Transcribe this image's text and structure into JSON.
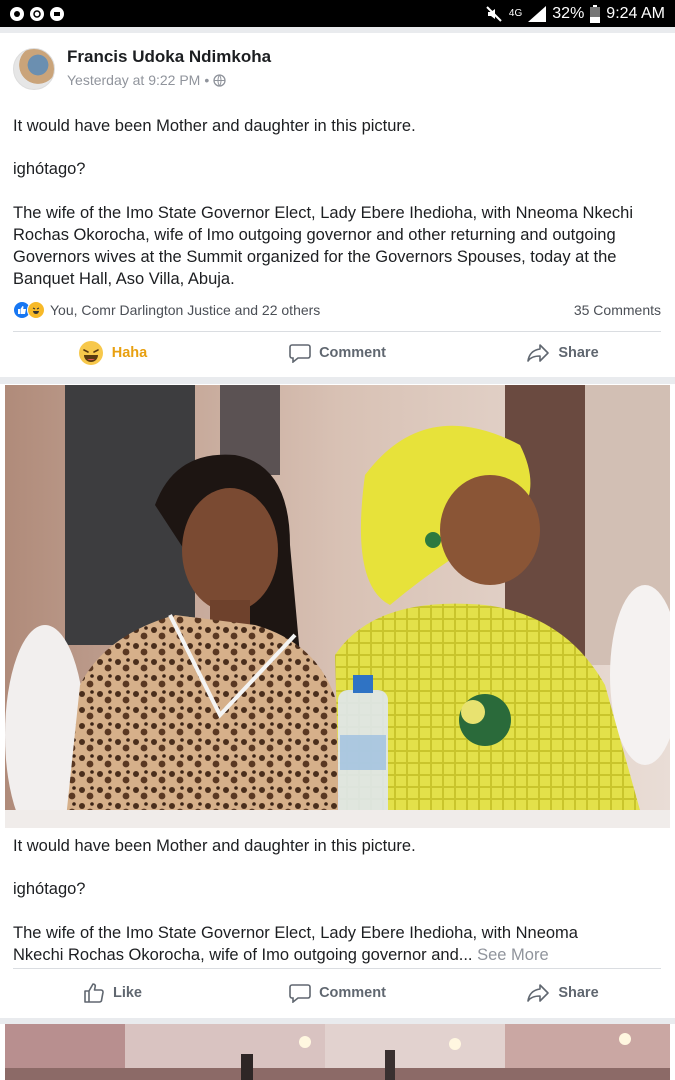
{
  "status_bar": {
    "network": "4G",
    "battery": "32%",
    "time": "9:24 AM"
  },
  "post1": {
    "author": "Francis Udoka Ndimkoha",
    "time": "Yesterday at 9:22 PM",
    "meta_sep": "•",
    "text_line1": "It would have been Mother and daughter in this picture.",
    "text_line2": "ighótago?",
    "text_line3a": "The wife of the Imo State Governor Elect, Lady Ebere Ihedioha, with Nneoma Nkechi",
    "text_line3b": "Rochas Okorocha, wife of Imo outgoing governor and other returning and outgoing",
    "text_line3c": "Governors wives at the Summit organized for the Governors Spouses, today at the",
    "text_line3d": "Banquet Hall, Aso Villa, Abuja.",
    "reactions_text": "You, Comr Darlington Justice and 22 others",
    "comments_count": "35 Comments",
    "actions": {
      "haha": "Haha",
      "comment": "Comment",
      "share": "Share"
    }
  },
  "post2": {
    "caption_line1": "It would have been Mother and daughter in this picture.",
    "caption_line2": "ighótago?",
    "caption_line3a": "The wife of the Imo State Governor Elect, Lady Ebere Ihedioha, with Nneoma",
    "caption_line3b": "Nkechi Rochas Okorocha, wife of Imo outgoing governor and...",
    "see_more": "See More",
    "actions": {
      "like": "Like",
      "comment": "Comment",
      "share": "Share"
    }
  },
  "colors": {
    "facebook_blue": "#1877f2",
    "haha_yellow": "#f7b928",
    "muted_text": "#90949c"
  }
}
